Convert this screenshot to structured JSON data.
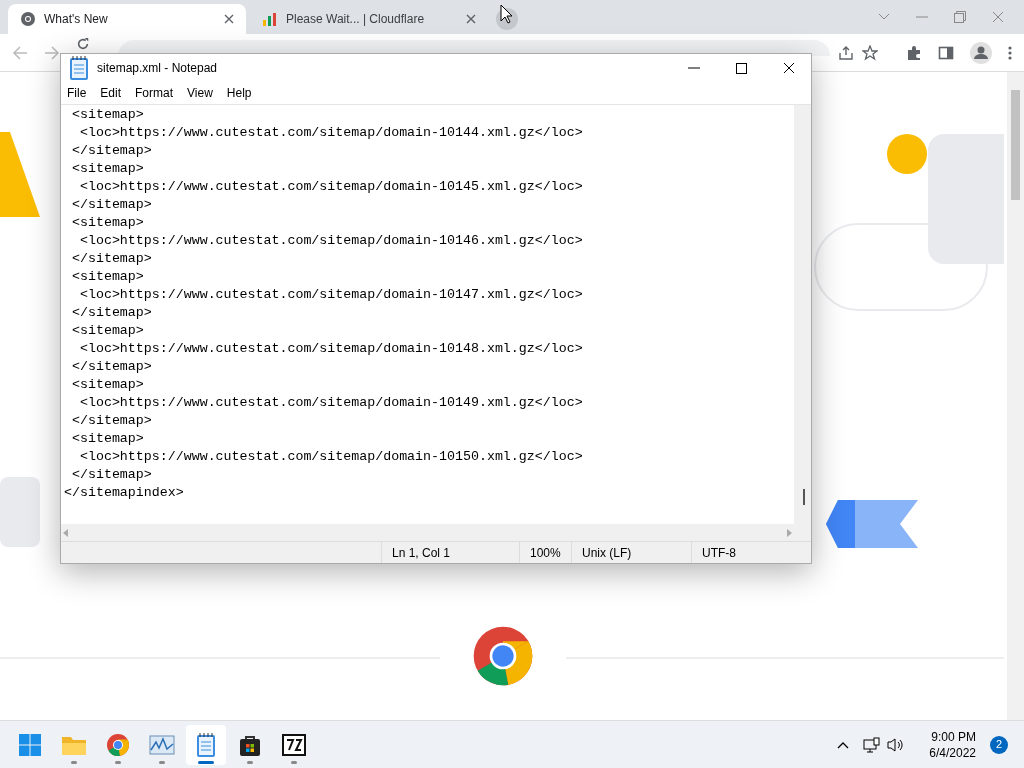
{
  "browser": {
    "tabs": [
      {
        "title": "What's New",
        "selected": true,
        "kind": "chrome"
      },
      {
        "title": "Please Wait... | Cloudflare",
        "selected": false,
        "kind": "bars"
      }
    ]
  },
  "notepad": {
    "title": "sitemap.xml - Notepad",
    "menu": [
      "File",
      "Edit",
      "Format",
      "View",
      "Help"
    ],
    "lines": [
      " <sitemap>",
      "  <loc>https://www.cutestat.com/sitemap/domain-10144.xml.gz</loc>",
      " </sitemap>",
      " <sitemap>",
      "  <loc>https://www.cutestat.com/sitemap/domain-10145.xml.gz</loc>",
      " </sitemap>",
      " <sitemap>",
      "  <loc>https://www.cutestat.com/sitemap/domain-10146.xml.gz</loc>",
      " </sitemap>",
      " <sitemap>",
      "  <loc>https://www.cutestat.com/sitemap/domain-10147.xml.gz</loc>",
      " </sitemap>",
      " <sitemap>",
      "  <loc>https://www.cutestat.com/sitemap/domain-10148.xml.gz</loc>",
      " </sitemap>",
      " <sitemap>",
      "  <loc>https://www.cutestat.com/sitemap/domain-10149.xml.gz</loc>",
      " </sitemap>",
      " <sitemap>",
      "  <loc>https://www.cutestat.com/sitemap/domain-10150.xml.gz</loc>",
      " </sitemap>",
      "</sitemapindex>"
    ],
    "status": [
      "Ln 1, Col 1",
      "100%",
      "Unix (LF)",
      "UTF-8"
    ]
  },
  "taskbar": {
    "apps": [
      {
        "kind": "explorer",
        "selected": false
      },
      {
        "kind": "chrome",
        "selected": false
      },
      {
        "kind": "monitor",
        "selected": false
      },
      {
        "kind": "notepad",
        "selected": true
      },
      {
        "kind": "store",
        "selected": false
      },
      {
        "kind": "zip",
        "selected": false
      }
    ],
    "time": "9:00 PM",
    "date": "6/4/2022",
    "notifications": "2"
  }
}
